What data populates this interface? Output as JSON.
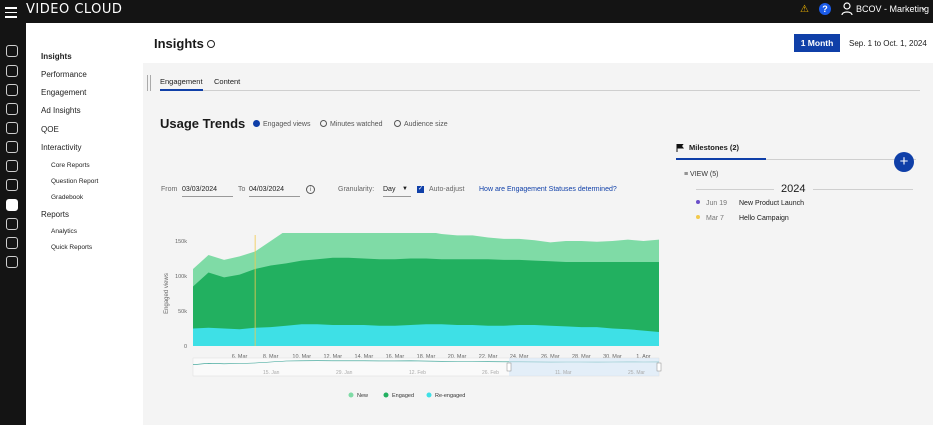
{
  "app": {
    "brand": "VIDEO CLOUD",
    "account": "BCOV - Marketing"
  },
  "sidenav": {
    "items": [
      {
        "label": "Insights",
        "level": 0,
        "bold": true
      },
      {
        "label": "Performance",
        "level": 0
      },
      {
        "label": "Engagement",
        "level": 0
      },
      {
        "label": "Ad Insights",
        "level": 0
      },
      {
        "label": "QOE",
        "level": 0
      },
      {
        "label": "Interactivity",
        "level": 0
      },
      {
        "label": "Core Reports",
        "level": 1
      },
      {
        "label": "Question Report",
        "level": 1
      },
      {
        "label": "Gradebook",
        "level": 1
      },
      {
        "label": "Reports",
        "level": 0
      },
      {
        "label": "Analytics",
        "level": 1
      },
      {
        "label": "Quick Reports",
        "level": 1
      }
    ]
  },
  "header": {
    "title": "Insights",
    "period_button": "1 Month",
    "date_range": "Sep. 1 to Oct. 1, 2024"
  },
  "tabs": [
    "Engagement",
    "Content"
  ],
  "usage": {
    "title": "Usage Trends",
    "metrics": [
      {
        "label": "Engaged views",
        "selected": true
      },
      {
        "label": "Minutes watched",
        "selected": false
      },
      {
        "label": "Audience size",
        "selected": false
      }
    ],
    "from_label": "From",
    "from_value": "03/03/2024",
    "to_label": "To",
    "to_value": "04/03/2024",
    "granularity_label": "Granularity:",
    "granularity_value": "Day",
    "auto_adjust_label": "Auto-adjust",
    "auto_adjust": true,
    "help_link": "How are Engagement Statuses determined?"
  },
  "milestones": {
    "tab_label": "Milestones (2)",
    "view_label": "VIEW (5)",
    "year": "2024",
    "items": [
      {
        "date": "Jun 19",
        "name": "New Product Launch",
        "color": "#6a4fc9"
      },
      {
        "date": "Mar 7",
        "name": "Hello Campaign",
        "color": "#f2c94c"
      }
    ]
  },
  "chart_data": {
    "type": "area",
    "ylabel": "Engaged views",
    "ylim": [
      0,
      150000
    ],
    "yticks": [
      "0",
      "50k",
      "100k",
      "150k"
    ],
    "xticks": [
      "6. Mar",
      "8. Mar",
      "10. Mar",
      "12. Mar",
      "14. Mar",
      "16. Mar",
      "18. Mar",
      "20. Mar",
      "22. Mar",
      "24. Mar",
      "26. Mar",
      "28. Mar",
      "30. Mar",
      "1. Apr"
    ],
    "navigator_ticks": [
      "15. Jan",
      "29. Jan",
      "12. Feb",
      "26. Feb",
      "11. Mar",
      "25. Mar"
    ],
    "x": [
      "3. Mar",
      "4. Mar",
      "5. Mar",
      "6. Mar",
      "7. Mar",
      "8. Mar",
      "9. Mar",
      "10. Mar",
      "11. Mar",
      "12. Mar",
      "13. Mar",
      "14. Mar",
      "15. Mar",
      "16. Mar",
      "17. Mar",
      "18. Mar",
      "19. Mar",
      "20. Mar",
      "21. Mar",
      "22. Mar",
      "23. Mar",
      "24. Mar",
      "25. Mar",
      "26. Mar",
      "27. Mar",
      "28. Mar",
      "29. Mar",
      "30. Mar",
      "31. Mar",
      "1. Apr",
      "2. Apr"
    ],
    "series": [
      {
        "name": "Re-engaged",
        "color": "#3ee0e6",
        "values": [
          25000,
          26000,
          25000,
          24000,
          26000,
          27000,
          29000,
          31000,
          31000,
          30000,
          30000,
          30000,
          29000,
          29000,
          30000,
          31000,
          31000,
          30000,
          30000,
          29000,
          29000,
          30000,
          30000,
          29000,
          28000,
          27000,
          27000,
          25000,
          24000,
          22000,
          20000
        ]
      },
      {
        "name": "Engaged",
        "color": "#22b060",
        "values": [
          85000,
          105000,
          98000,
          102000,
          110000,
          115000,
          118000,
          122000,
          124000,
          126000,
          126000,
          125000,
          124000,
          124000,
          125000,
          125000,
          124000,
          124000,
          124000,
          124000,
          123000,
          123000,
          122000,
          121000,
          120000,
          120000,
          120000,
          120000,
          120000,
          120000,
          120000
        ]
      },
      {
        "name": "New",
        "color": "#7fdba6",
        "values": [
          110000,
          130000,
          123000,
          128000,
          135000,
          150000,
          165000,
          168000,
          170000,
          168000,
          168000,
          168000,
          167000,
          166000,
          168000,
          164000,
          160000,
          158000,
          158000,
          155000,
          153000,
          153000,
          151000,
          148000,
          150000,
          150000,
          149000,
          150000,
          152000,
          150000,
          152000
        ]
      }
    ]
  }
}
